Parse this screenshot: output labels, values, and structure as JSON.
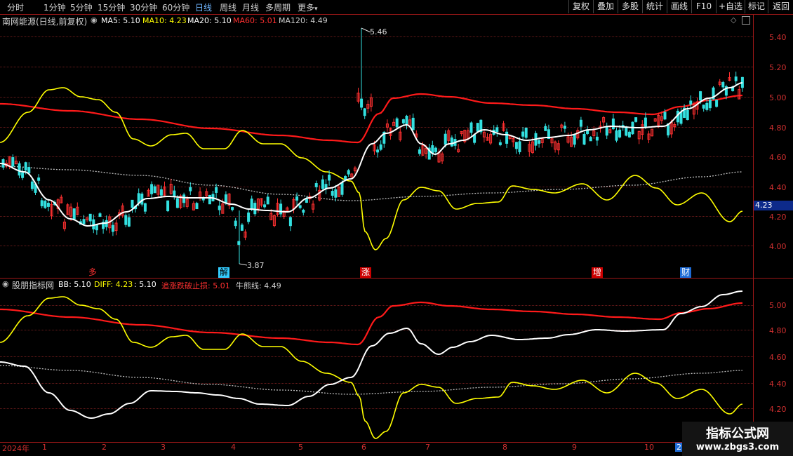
{
  "toolbar": {
    "timeframes": [
      "分时",
      "1分钟",
      "5分钟",
      "15分钟",
      "30分钟",
      "60分钟",
      "日线",
      "周线",
      "月线",
      "多周期",
      "更多"
    ],
    "active": "日线",
    "more_arrow": "▾",
    "right_buttons": [
      "复权",
      "叠加",
      "多股",
      "统计",
      "画线",
      "F10",
      "+自选",
      "标记",
      "返回"
    ]
  },
  "main_panel": {
    "title": "南网能源(日线,前复权)",
    "indicators": [
      {
        "label": "MA5: 5.10",
        "color": "#ffffff"
      },
      {
        "label": "MA10: 4.23",
        "color": "#ffff00"
      },
      {
        "label": "MA20: 5.10",
        "color": "#ffffff"
      },
      {
        "label": "MA60: 5.01",
        "color": "#ff3030"
      },
      {
        "label": "MA120: 4.49",
        "color": "#cccccc"
      }
    ],
    "price_labels": [
      "5.40",
      "5.20",
      "5.00",
      "4.80",
      "4.60",
      "4.40",
      "4.20",
      "4.00"
    ],
    "current_value": "4.23",
    "high_label": "5.46",
    "low_label": "3.87",
    "markers": [
      {
        "text": "多",
        "color": "#ff3030",
        "bg": "none"
      },
      {
        "text": "解",
        "color": "#000000",
        "bg": "#33ccff"
      },
      {
        "text": "涨",
        "color": "#ffffff",
        "bg": "#cc0000"
      },
      {
        "text": "增",
        "color": "#ffffff",
        "bg": "#cc0000"
      },
      {
        "text": "财",
        "color": "#ffffff",
        "bg": "#1e6bd6"
      }
    ]
  },
  "sub_panel": {
    "title": "股朋指标网",
    "indicators": [
      {
        "label": "BB: 5.10",
        "color": "#ffffff"
      },
      {
        "label": "DIFF: 4.23",
        "color": "#ffff00"
      },
      {
        "label": ": 5.10",
        "color": "#ffffff"
      },
      {
        "label": "追涨跌破止损: 5.01",
        "color": "#ff3030"
      },
      {
        "label": "牛熊线: 4.49",
        "color": "#cccccc"
      }
    ],
    "price_labels": [
      "5.00",
      "4.80",
      "4.60",
      "4.40",
      "4.20"
    ]
  },
  "time_axis": {
    "year": "2024年",
    "months": [
      "1",
      "2",
      "3",
      "4",
      "5",
      "6",
      "7",
      "8",
      "9",
      "10",
      "2"
    ]
  },
  "watermark": {
    "title": "指标公式网",
    "url": "www.zbgs3.com"
  },
  "chart_data": {
    "type": "line",
    "title": "南网能源(日线,前复权)",
    "y_range_main": [
      3.87,
      5.46
    ],
    "series": [
      {
        "name": "MA5",
        "values": [
          5.1
        ]
      },
      {
        "name": "MA10",
        "values": [
          4.23
        ]
      },
      {
        "name": "MA20",
        "values": [
          5.1
        ]
      },
      {
        "name": "MA60",
        "values": [
          5.01
        ]
      },
      {
        "name": "MA120",
        "values": [
          4.49
        ]
      }
    ],
    "high": 5.46,
    "low": 3.87
  }
}
